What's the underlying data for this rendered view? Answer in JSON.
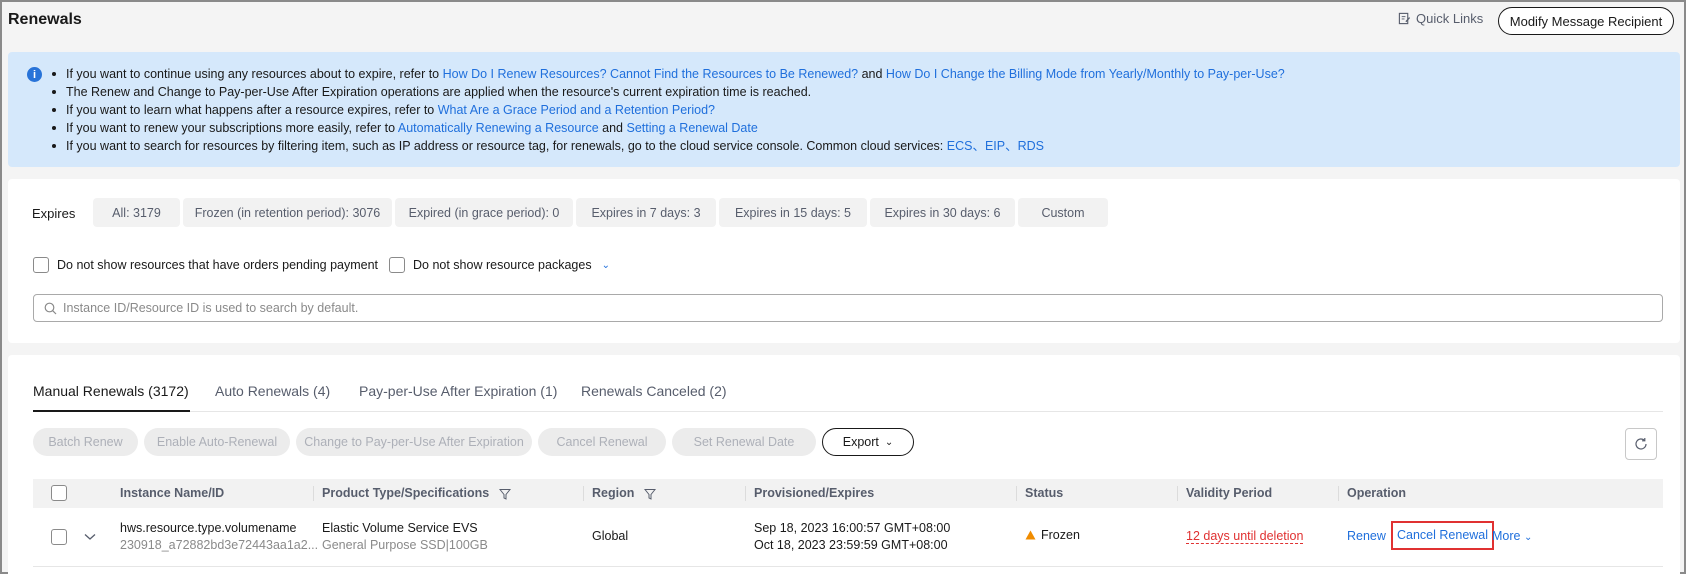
{
  "header": {
    "title": "Renewals",
    "quick_links": "Quick Links",
    "modify_btn": "Modify Message Recipient"
  },
  "banner": {
    "line1": {
      "prefix": "If you want to continue using any resources about to expire, refer to ",
      "link1": "How Do I Renew Resources? Cannot Find the Resources to Be Renewed?",
      "mid": " and ",
      "link2": "How Do I Change the Billing Mode from Yearly/Monthly to Pay-per-Use?"
    },
    "line2": "The Renew and Change to Pay-per-Use After Expiration operations are applied when the resource's current expiration time is reached.",
    "line3": {
      "prefix": "If you want to learn what happens after a resource expires, refer to ",
      "link": "What Are a Grace Period and a Retention Period?"
    },
    "line4": {
      "prefix": "If you want to renew your subscriptions more easily, refer to ",
      "link1": "Automatically Renewing a Resource",
      "mid": " and ",
      "link2": "Setting a Renewal Date"
    },
    "line5": {
      "prefix": "If you want to search for resources by filtering item, such as IP address or resource tag, for renewals, go to the cloud service console. Common cloud services: ",
      "link1": "ECS",
      "sep1": "、",
      "link2": "EIP",
      "sep2": "、",
      "link3": "RDS"
    }
  },
  "filters": {
    "expires_label": "Expires",
    "chips": [
      "All: 3179",
      "Frozen (in retention period): 3076",
      "Expired (in grace period): 0",
      "Expires in 7 days: 3",
      "Expires in 15 days: 5",
      "Expires in 30 days: 6",
      "Custom"
    ],
    "check_pending": "Do not show resources that have orders pending payment",
    "check_packages": "Do not show resource packages",
    "search_placeholder": "Instance ID/Resource ID is used to search by default."
  },
  "tabs": [
    "Manual Renewals (3172)",
    "Auto Renewals (4)",
    "Pay-per-Use After Expiration (1)",
    "Renewals Canceled (2)"
  ],
  "toolbar": {
    "batch_renew": "Batch Renew",
    "enable_auto": "Enable Auto-Renewal",
    "change_ppu": "Change to Pay-per-Use After Expiration",
    "cancel_renewal": "Cancel Renewal",
    "set_date": "Set Renewal Date",
    "export": "Export"
  },
  "table": {
    "headers": {
      "name": "Instance Name/ID",
      "product": "Product Type/Specifications",
      "region": "Region",
      "provisioned": "Provisioned/Expires",
      "status": "Status",
      "validity": "Validity Period",
      "operation": "Operation"
    },
    "rows": [
      {
        "name": "hws.resource.type.volumename",
        "id": "230918_a72882bd3e72443aa1a2...",
        "product": "Elastic Volume Service EVS",
        "spec": "General Purpose SSD|100GB",
        "region": "Global",
        "provisioned": "Sep 18, 2023 16:00:57 GMT+08:00",
        "expires": "Oct 18, 2023 23:59:59 GMT+08:00",
        "status": "Frozen",
        "validity": "12 days until deletion",
        "op_renew": "Renew",
        "op_cancel": "Cancel Renewal",
        "op_more": "More"
      }
    ]
  },
  "colors": {
    "link": "#1f6fdc",
    "danger": "#e03131",
    "banner_bg": "#d5e8fb",
    "frozen": "#f08c00"
  }
}
